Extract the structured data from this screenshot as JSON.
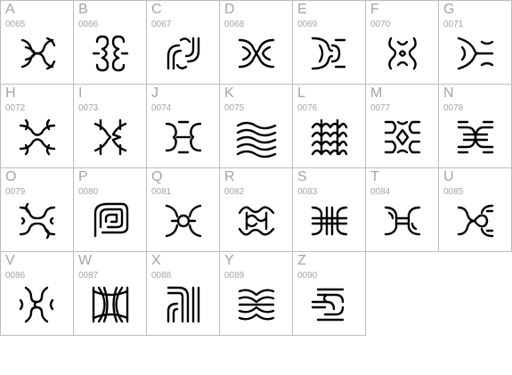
{
  "glyph_grid": {
    "cells": [
      {
        "letter": "A",
        "code": "0065",
        "icon": "ornamental-glyph-icon"
      },
      {
        "letter": "B",
        "code": "0066",
        "icon": "ornamental-glyph-icon"
      },
      {
        "letter": "C",
        "code": "0067",
        "icon": "ornamental-glyph-icon"
      },
      {
        "letter": "D",
        "code": "0068",
        "icon": "ornamental-glyph-icon"
      },
      {
        "letter": "E",
        "code": "0069",
        "icon": "ornamental-glyph-icon"
      },
      {
        "letter": "F",
        "code": "0070",
        "icon": "ornamental-glyph-icon"
      },
      {
        "letter": "G",
        "code": "0071",
        "icon": "ornamental-glyph-icon"
      },
      {
        "letter": "H",
        "code": "0072",
        "icon": "ornamental-glyph-icon"
      },
      {
        "letter": "I",
        "code": "0073",
        "icon": "ornamental-glyph-icon"
      },
      {
        "letter": "J",
        "code": "0074",
        "icon": "ornamental-glyph-icon"
      },
      {
        "letter": "K",
        "code": "0075",
        "icon": "ornamental-glyph-icon"
      },
      {
        "letter": "L",
        "code": "0076",
        "icon": "ornamental-glyph-icon"
      },
      {
        "letter": "M",
        "code": "0077",
        "icon": "ornamental-glyph-icon"
      },
      {
        "letter": "N",
        "code": "0078",
        "icon": "ornamental-glyph-icon"
      },
      {
        "letter": "O",
        "code": "0079",
        "icon": "ornamental-glyph-icon"
      },
      {
        "letter": "P",
        "code": "0080",
        "icon": "ornamental-glyph-icon"
      },
      {
        "letter": "Q",
        "code": "0081",
        "icon": "ornamental-glyph-icon"
      },
      {
        "letter": "R",
        "code": "0082",
        "icon": "ornamental-glyph-icon"
      },
      {
        "letter": "S",
        "code": "0083",
        "icon": "ornamental-glyph-icon"
      },
      {
        "letter": "T",
        "code": "0084",
        "icon": "ornamental-glyph-icon"
      },
      {
        "letter": "U",
        "code": "0085",
        "icon": "ornamental-glyph-icon"
      },
      {
        "letter": "V",
        "code": "0086",
        "icon": "ornamental-glyph-icon"
      },
      {
        "letter": "W",
        "code": "0087",
        "icon": "ornamental-glyph-icon"
      },
      {
        "letter": "X",
        "code": "0088",
        "icon": "ornamental-glyph-icon"
      },
      {
        "letter": "Y",
        "code": "0089",
        "icon": "ornamental-glyph-icon"
      },
      {
        "letter": "Z",
        "code": "0090",
        "icon": "ornamental-glyph-icon"
      }
    ],
    "colors": {
      "border": "#bdbdbd",
      "label": "#a4a4a4",
      "glyph": "#000000"
    }
  }
}
